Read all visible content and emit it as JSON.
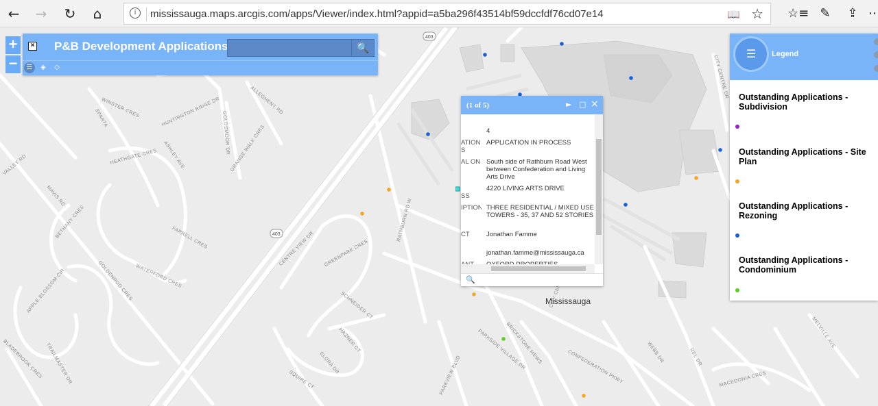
{
  "browser": {
    "back_icon": "←",
    "forward_icon": "→",
    "refresh_icon": "↻",
    "home_icon": "⌂",
    "url": "mississauga.maps.arcgis.com/apps/Viewer/index.html?appid=a5ba296f43514bf59dccfdf76cd07e14",
    "info_icon": "i",
    "reading_icon": "📖",
    "favorite_icon": "☆",
    "favorites_list_icon": "☆≡",
    "notes_icon": "✎",
    "share_icon": "⇪",
    "more_icon": "⋯"
  },
  "zoom": {
    "in_label": "+",
    "out_label": "−"
  },
  "app": {
    "title": "P&B Development Applications",
    "close_label": "×",
    "search_placeholder": "",
    "search_icon": "🔍"
  },
  "popup": {
    "count": "(1 of 5)",
    "next_icon": "►",
    "maximize_icon": "□",
    "close_icon": "×",
    "rows": [
      {
        "label": "",
        "value": "4"
      },
      {
        "label": "ATION S",
        "value": "APPLICATION IN PROCESS"
      },
      {
        "label": "AL ON",
        "value": "South side of Rathburn Road West between Confederation and Living Arts Drive"
      },
      {
        "label": "SS",
        "value": "4220 LIVING ARTS DRIVE"
      },
      {
        "label": "IPTION",
        "value": "THREE RESIDENTIAL / MIXED USE TOWERS - 35, 37 AND 52 STORIES"
      },
      {
        "label": "CT",
        "value": "Jonathan Famme"
      },
      {
        "label": "",
        "value": "jonathan.famme@mississauga.ca"
      },
      {
        "label": "ANT",
        "value": "OXFORD PROPERTIES"
      }
    ],
    "zoom_to_icon": "🔍"
  },
  "legend": {
    "title": "Legend",
    "icon": "☰",
    "items": [
      {
        "title": "Outstanding Applications - Subdivision",
        "color": "#9b1fc9"
      },
      {
        "title": "Outstanding Applications - Site Plan",
        "color": "#f5a623"
      },
      {
        "title": "Outstanding Applications - Rezoning",
        "color": "#1a5fd6"
      },
      {
        "title": "Outstanding Applications - Condominium",
        "color": "#5ad11f"
      }
    ]
  },
  "map": {
    "place_label": "Mississauga",
    "highway_shields": [
      "403",
      "403"
    ],
    "road_labels": [
      "WINSTER CRES",
      "SPARTA",
      "HUNTINGTON RIDGE DR",
      "ALLEGHENY RD",
      "GOLDSMOOR DR",
      "ORANGE WALK CRES",
      "ASHLEY AVE",
      "HEATHGATE CRES",
      "VALLEY RD",
      "MAVIS RD",
      "BETHANY CRES",
      "FARRELL CRES",
      "CENTRE VIEW DR",
      "GREENPARK CRES",
      "RATHBURN RD W",
      "WATERFORD CRES",
      "GOLDENROD CRES",
      "APPLE BLOSSOM CIR",
      "TRAILMASTER DR",
      "SCHNEIDER CT",
      "HAZNER CT",
      "ELORA DR",
      "SQUIRE CT",
      "PARKSIDE VILLAGE DR",
      "BRICKSTONE MEWS",
      "CITY CENTRE DR",
      "CONFEDERATION PKWY",
      "WEBB DR",
      "REL DR",
      "MACEDONIA CRES",
      "MELVILLE AVE",
      "PARKVIEW BLVD",
      "BLADEBROOK CRES",
      "CITY CENTRE DR"
    ]
  }
}
